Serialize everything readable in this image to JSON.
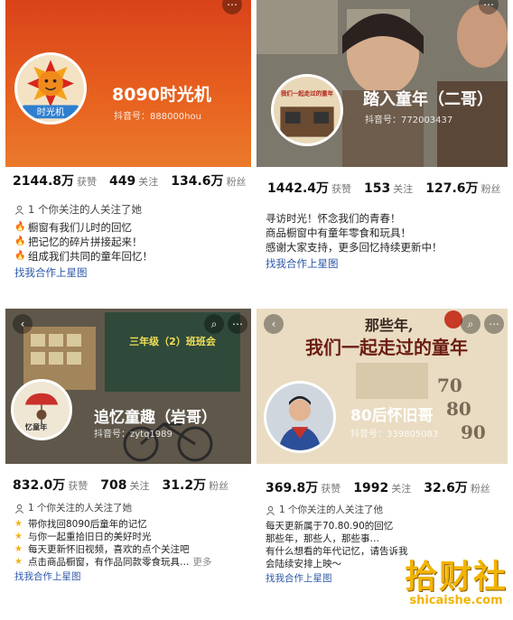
{
  "accounts": [
    {
      "name": "8090时光机",
      "douyin_id": "抖音号：888000hou",
      "likes": "2144.8万",
      "likes_label": "获赞",
      "following": "449",
      "following_label": "关注",
      "fans": "134.6万",
      "fans_label": "粉丝",
      "mutual": "1 个你关注的人关注了她",
      "bio": [
        "橱窗有我们儿时的回忆",
        "把记忆的碎片拼接起来！",
        "组成我们共同的童年回忆！"
      ],
      "link": "找我合作上星图",
      "avatar_text": "时光机"
    },
    {
      "name": "踏入童年（二哥）",
      "douyin_id": "抖音号：772003437",
      "likes": "1442.4万",
      "likes_label": "获赞",
      "following": "153",
      "following_label": "关注",
      "fans": "127.6万",
      "fans_label": "粉丝",
      "bio": [
        "寻访时光！怀念我们的青春！",
        "商品橱窗中有童年零食和玩具！",
        "感谢大家支持，更多回忆持续更新中！"
      ],
      "link": "找我合作上星图",
      "avatar_text": "我们一起走过的童年"
    },
    {
      "name": "追忆童趣（岩哥）",
      "douyin_id": "抖音号：zytq1989",
      "likes": "832.0万",
      "likes_label": "获赞",
      "following": "708",
      "following_label": "关注",
      "fans": "31.2万",
      "fans_label": "粉丝",
      "mutual": "1 个你关注的人关注了她",
      "bio": [
        "带你找回8090后童年的记忆",
        "与你一起重拾旧日的美好时光",
        "每天更新怀旧视频，喜欢的点个关注吧",
        "点击商品橱窗，有作品同款零食玩具…"
      ],
      "more": "更多",
      "link": "找我合作上星图",
      "banner_text": "三年级（2）班班会",
      "avatar_text": "忆童年"
    },
    {
      "name": "80后怀旧哥",
      "douyin_id": "抖音号：339805083",
      "likes": "369.8万",
      "likes_label": "获赞",
      "following": "1992",
      "following_label": "关注",
      "fans": "32.6万",
      "fans_label": "粉丝",
      "mutual": "1 个你关注的人关注了他",
      "bio": [
        "每天更新属于70.80.90的回忆",
        "那些年，那些人，那些事…",
        "有什么想看的年代记忆，请告诉我",
        "会陆续安排上映～"
      ],
      "link": "找我合作上星图",
      "banner_text_1": "那些年,",
      "banner_text_2": "我们一起走过的童年",
      "years": [
        "70",
        "80",
        "90"
      ]
    }
  ],
  "watermark": {
    "main": "拾财社",
    "sub": "shicaishe.com"
  },
  "colors": {
    "orange": "#e0501c",
    "link": "#2c57a8",
    "gold": "#f2b400"
  }
}
